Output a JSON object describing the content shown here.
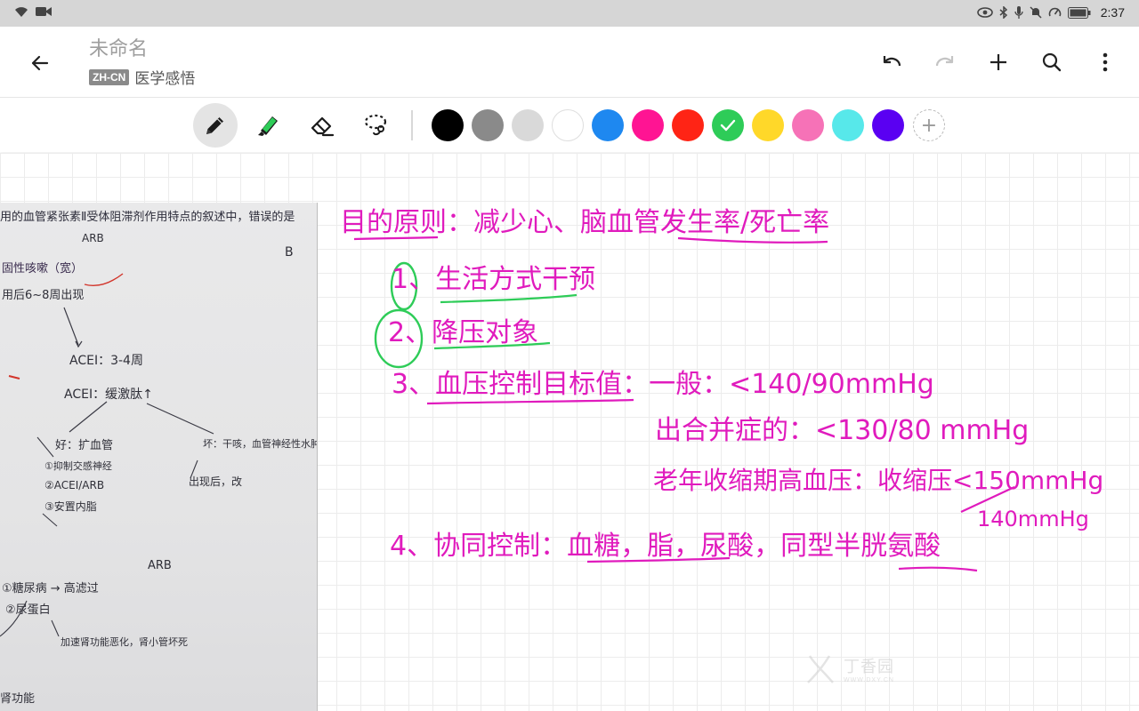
{
  "status_bar": {
    "time": "2:37",
    "left_icons": [
      "wifi-icon",
      "video-camera-icon"
    ],
    "right_icons": [
      "eye-icon",
      "bluetooth-icon",
      "microphone-icon",
      "bell-off-icon",
      "speedometer-icon",
      "battery-icon"
    ]
  },
  "app_bar": {
    "title": "未命名",
    "language_badge": "ZH-CN",
    "notebook": "医学感悟",
    "actions": [
      "undo-icon",
      "redo-icon",
      "add-icon",
      "search-icon",
      "more-vertical-icon"
    ]
  },
  "toolbar": {
    "tools": [
      "pen-icon",
      "highlighter-icon",
      "eraser-icon",
      "lasso-icon"
    ],
    "active_tool": "pen-icon",
    "colors": [
      "#000000",
      "#8a8a8a",
      "#d9d9d9",
      "#ffffff",
      "#1e88f0",
      "#ff1493",
      "#ff2415",
      "#2ecc58",
      "#ffd829",
      "#f672b7",
      "#57e8ea",
      "#5a00f2"
    ],
    "selected_color": "#2ecc58",
    "ink_color": "#e01bbd"
  },
  "note": {
    "handwritten_lines": [
      "目的原则：减少心、脑血管发生率/死亡率",
      "1、生活方式干预",
      "2、降压对象",
      "3、血压控制目标值：一般：<140/90mmHg",
      "出合并症的：<130/80 mmHg",
      "老年收缩期高血压：收缩压<150mmHg",
      "140mmHg",
      "4、协同控制：血糖，脂，尿酸，同型半胱氨酸"
    ],
    "photo_lines": [
      "用的血管紧张素Ⅱ受体阻滞剂作用特点的叙述中，错误的是",
      "ARB",
      "B",
      "固性咳嗽（宽）",
      "用后6~8周出现",
      "ACEI：3-4周",
      "ACEI：缓激肽↑",
      "好：扩血管",
      "坏：干咳，血管神经性水肿",
      "①抑制交感神经",
      "②ACEI/ARB",
      "③安置内脂",
      "出现后，改",
      "ARB",
      "①糖尿病 → 高滤过",
      "②尿蛋白",
      "加速肾功能恶化，肾小管坏死",
      "肾功能"
    ]
  },
  "watermark": {
    "text": "丁香园",
    "sub": "WWW.DXY.CN"
  }
}
